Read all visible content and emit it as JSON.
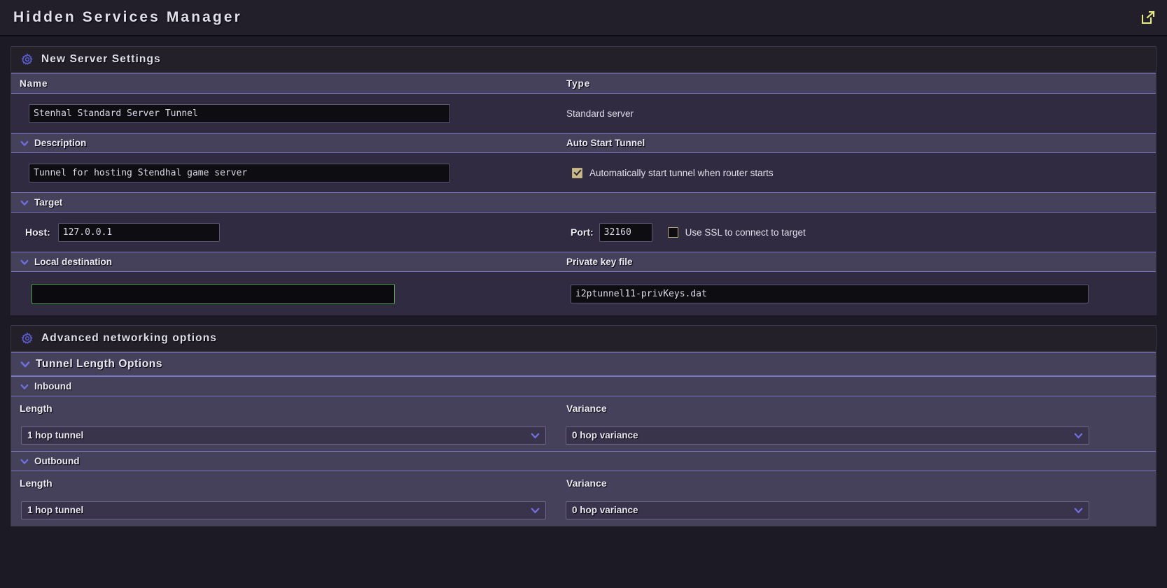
{
  "titlebar": {
    "title": "Hidden Services Manager",
    "popout_icon": "external-link-icon"
  },
  "panels": {
    "new_server": {
      "title": "New Server Settings",
      "icon": "gear-icon"
    },
    "advanced": {
      "title": "Advanced networking options",
      "icon": "gear-icon"
    }
  },
  "table": {
    "headers": {
      "name": "Name",
      "type": "Type"
    },
    "name_value": "Stenhal Standard Server Tunnel",
    "type_value": "Standard server"
  },
  "description": {
    "heading": "Description",
    "value": "Tunnel for hosting Stendhal game server"
  },
  "auto_start": {
    "heading": "Auto Start Tunnel",
    "checkbox_label": "Automatically start tunnel when router starts",
    "checked": true
  },
  "target": {
    "heading": "Target",
    "host_label": "Host:",
    "host_value": "127.0.0.1",
    "port_label": "Port:",
    "port_value": "32160",
    "ssl_label": "Use SSL to connect to target",
    "ssl_checked": false
  },
  "local_destination": {
    "heading": "Local destination",
    "value": "",
    "placeholder": ""
  },
  "private_key": {
    "heading": "Private key file",
    "value": "i2ptunnel11-privKeys.dat"
  },
  "tunnel_length": {
    "heading": "Tunnel Length Options",
    "inbound": {
      "heading": "Inbound",
      "length_label": "Length",
      "length_value": "1 hop tunnel",
      "variance_label": "Variance",
      "variance_value": "0 hop variance"
    },
    "outbound": {
      "heading": "Outbound",
      "length_label": "Length",
      "length_value": "1 hop tunnel",
      "variance_label": "Variance",
      "variance_value": "0 hop variance"
    }
  },
  "colors": {
    "page_bg": "#1c1a24",
    "titlebar_bg": "#221f2b",
    "row_bg": "#302b41",
    "head_band": "#45415a",
    "separator": "#7b79c4",
    "accent_chevron": "#6f6fe0",
    "popout_icon": "#e8eb83",
    "checkbox_fill": "#c7b98c",
    "focus_border": "#4f9a4f"
  }
}
